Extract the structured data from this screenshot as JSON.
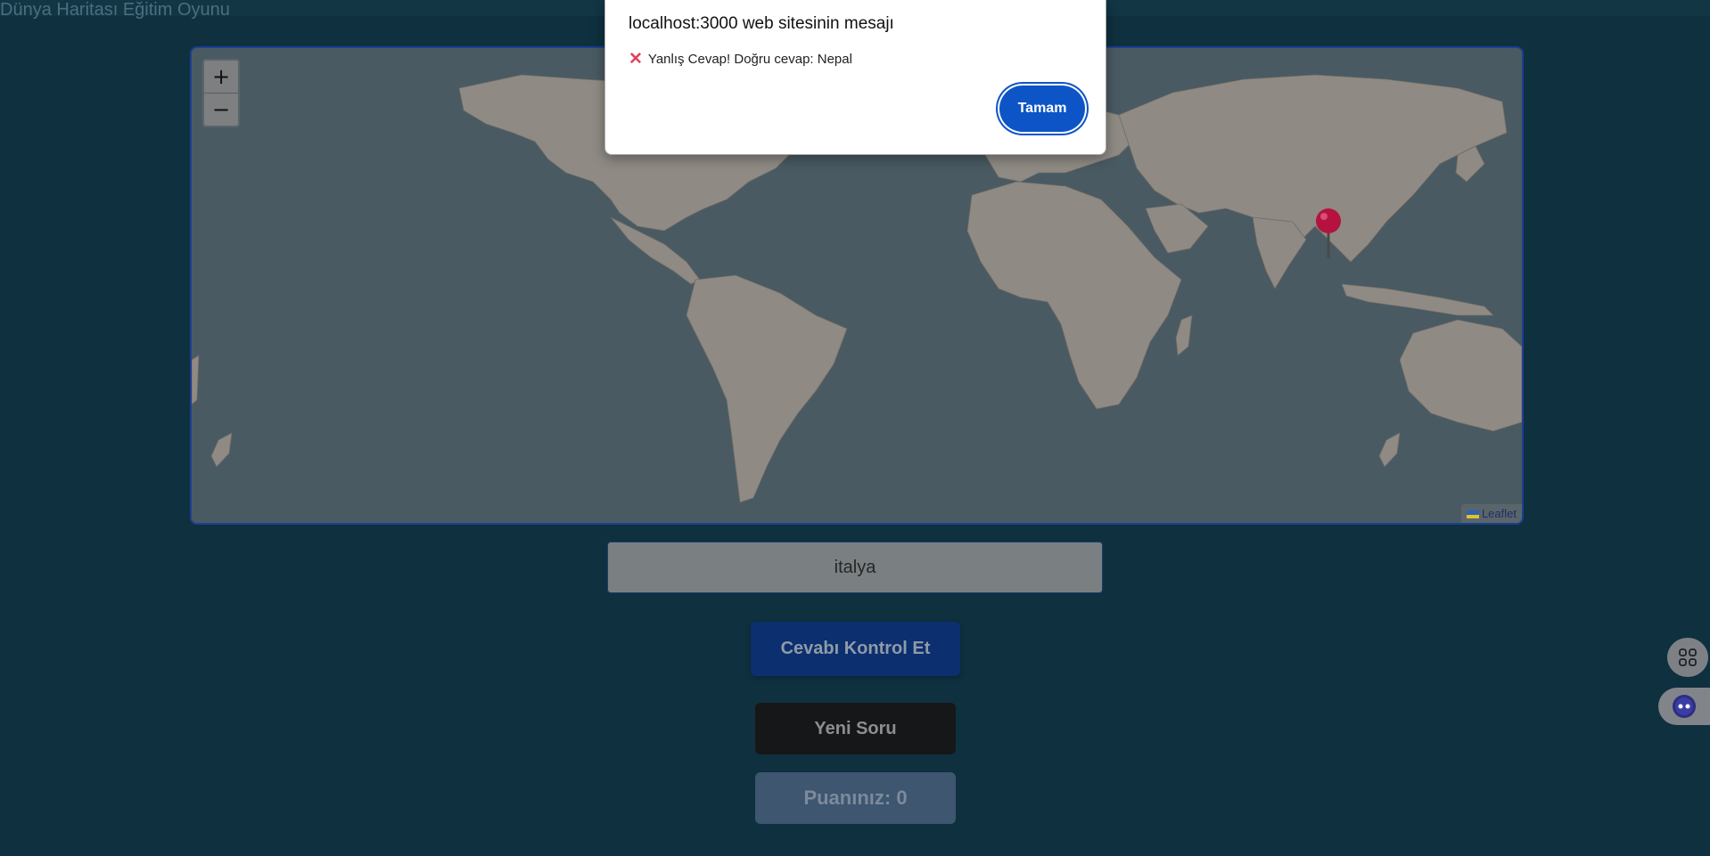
{
  "page": {
    "title": "Dünya Haritası Eğitim Oyunu"
  },
  "map": {
    "zoom_in_label": "+",
    "zoom_out_label": "−",
    "attribution": "Leaflet",
    "ocean_color": "#495a62",
    "land_color": "#8f8a84",
    "marker_color": "#b5123f"
  },
  "quiz": {
    "answer_value": "italya",
    "check_button": "Cevabı Kontrol Et",
    "new_question_button": "Yeni Soru",
    "score_text": "Puanınız: 0"
  },
  "dialog": {
    "title": "localhost:3000 web sitesinin mesajı",
    "message": "Yanlış Cevap! Doğru cevap: Nepal",
    "icon": "cross-mark-icon",
    "ok_button": "Tamam"
  },
  "side_tools": {
    "apps_icon": "apps-grid-icon",
    "assistant_icon": "assistant-bot-icon"
  }
}
